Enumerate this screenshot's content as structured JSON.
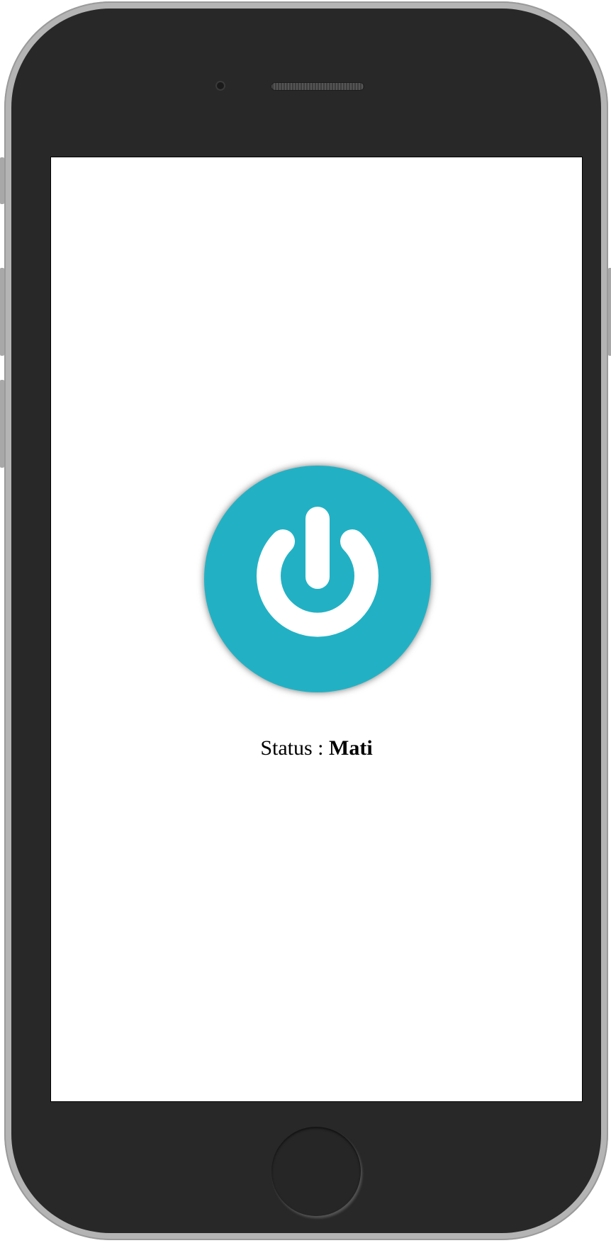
{
  "status": {
    "label": "Status : ",
    "value": "Mati"
  },
  "power_button": {
    "icon": "power-icon",
    "color": "#22b1c4",
    "state": "off"
  },
  "device": {
    "frame_color": "#282828",
    "bezel_color": "#b4b4b4"
  }
}
